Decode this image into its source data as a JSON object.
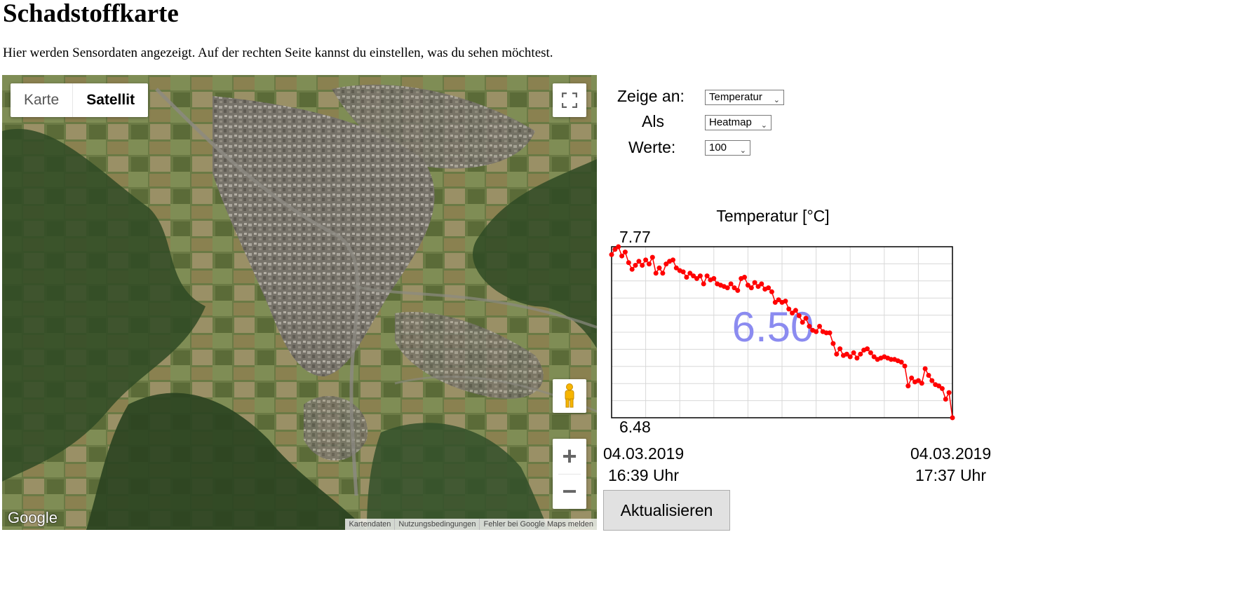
{
  "page": {
    "title": "Schadstoffkarte",
    "intro": "Hier werden Sensordaten angezeigt. Auf der rechten Seite kannst du einstellen, was du sehen möchtest."
  },
  "map": {
    "type_karte": "Karte",
    "type_satellit": "Satellit",
    "active_type": "Satellit",
    "zoom_in": "+",
    "zoom_out": "−",
    "logo": "Google",
    "attribution": [
      "Kartendaten",
      "Nutzungsbedingungen",
      "Fehler bei Google Maps melden"
    ],
    "icons": {
      "fullscreen": "fullscreen-icon",
      "pegman": "pegman-icon"
    }
  },
  "controls": {
    "show_label": "Zeige an:",
    "show_value": "Temperatur",
    "as_label": "Als",
    "as_value": "Heatmap",
    "values_label": "Werte:",
    "values_value": "100",
    "refresh_label": "Aktualisieren"
  },
  "chart_data": {
    "type": "line",
    "title": "Temperatur [°C]",
    "max_label": "7.77",
    "min_label": "6.48",
    "current_label": "6.50",
    "start_date": "04.03.2019",
    "start_time": "16:39 Uhr",
    "end_date": "04.03.2019",
    "end_time": "17:37 Uhr",
    "ylim": [
      6.48,
      7.77
    ],
    "line_color": "#ff0000",
    "current_color": "#8b8bf0",
    "grid": true,
    "values": [
      7.71,
      7.75,
      7.77,
      7.7,
      7.73,
      7.65,
      7.6,
      7.63,
      7.66,
      7.63,
      7.67,
      7.64,
      7.69,
      7.57,
      7.61,
      7.57,
      7.64,
      7.66,
      7.67,
      7.61,
      7.59,
      7.58,
      7.54,
      7.57,
      7.55,
      7.53,
      7.55,
      7.49,
      7.55,
      7.52,
      7.53,
      7.49,
      7.48,
      7.47,
      7.46,
      7.49,
      7.46,
      7.44,
      7.53,
      7.54,
      7.48,
      7.46,
      7.5,
      7.47,
      7.49,
      7.45,
      7.46,
      7.43,
      7.35,
      7.37,
      7.35,
      7.36,
      7.3,
      7.27,
      7.29,
      7.25,
      7.2,
      7.23,
      7.17,
      7.14,
      7.13,
      7.17,
      7.13,
      7.12,
      7.12,
      7.04,
      6.96,
      7.0,
      6.95,
      6.96,
      6.94,
      6.97,
      6.93,
      6.96,
      6.99,
      7.0,
      6.97,
      6.94,
      6.92,
      6.93,
      6.94,
      6.93,
      6.92,
      6.92,
      6.91,
      6.9,
      6.87,
      6.72,
      6.78,
      6.75,
      6.76,
      6.74,
      6.85,
      6.8,
      6.76,
      6.73,
      6.72,
      6.7,
      6.62,
      6.67,
      6.48
    ]
  }
}
